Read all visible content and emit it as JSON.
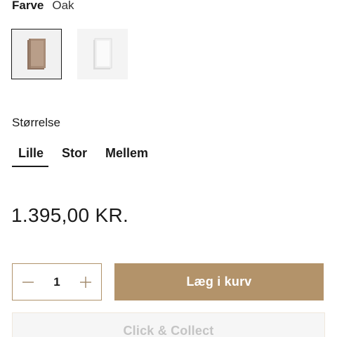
{
  "color": {
    "label": "Farve",
    "selected_value": "Oak",
    "swatches": [
      {
        "name": "Oak",
        "selected": true,
        "color": "#a58a74"
      },
      {
        "name": "White",
        "selected": false,
        "color": "#e8e8e8"
      }
    ]
  },
  "size": {
    "label": "Størrelse",
    "options": [
      {
        "label": "Lille",
        "selected": true
      },
      {
        "label": "Stor",
        "selected": false
      },
      {
        "label": "Mellem",
        "selected": false
      }
    ]
  },
  "price": "1.395,00 KR.",
  "quantity": {
    "value": "1",
    "decrement_icon": "minus-icon",
    "increment_icon": "plus-icon"
  },
  "actions": {
    "add_to_cart": "Læg i kurv",
    "click_collect": "Click & Collect"
  },
  "colors": {
    "accent": "#b3936a",
    "text": "#1a1a1a"
  }
}
